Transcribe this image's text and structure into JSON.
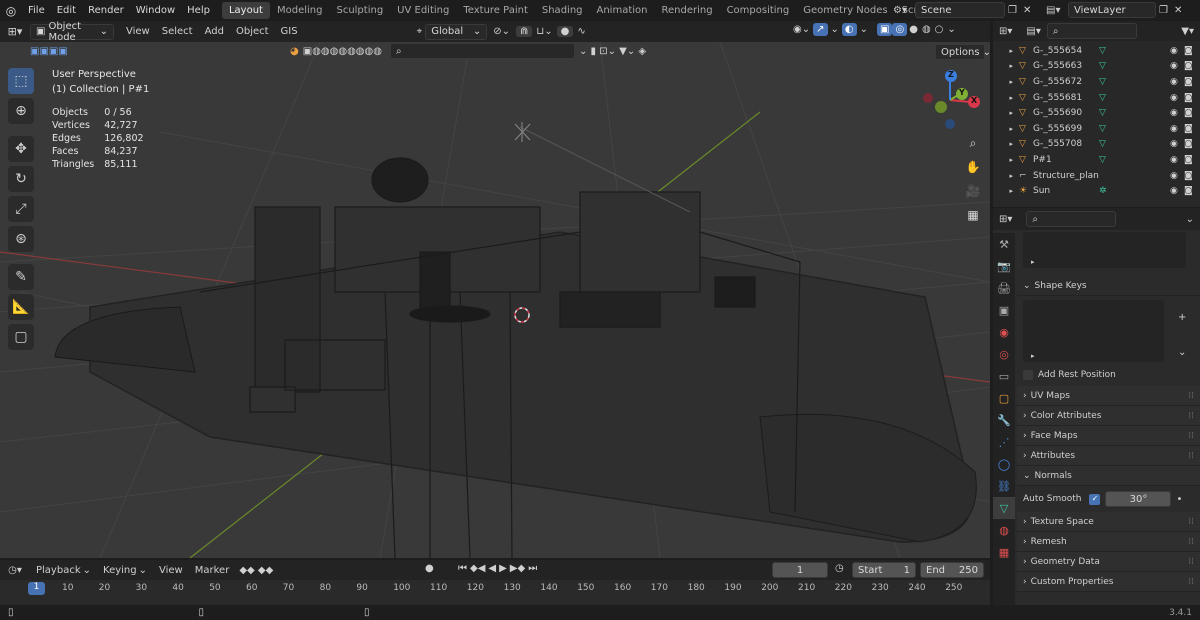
{
  "topbar": {
    "menus": [
      "File",
      "Edit",
      "Render",
      "Window",
      "Help"
    ],
    "workspaces": [
      "Layout",
      "Modeling",
      "Sculpting",
      "UV Editing",
      "Texture Paint",
      "Shading",
      "Animation",
      "Rendering",
      "Compositing",
      "Geometry Nodes",
      "Scripting"
    ],
    "active_workspace": "Layout",
    "add_tab": "+",
    "scene": "Scene",
    "view_layer": "ViewLayer"
  },
  "viewport_header": {
    "mode": "Object Mode",
    "menus": [
      "View",
      "Select",
      "Add",
      "Object",
      "GIS"
    ],
    "orientation": "Global",
    "options": "Options"
  },
  "overlay": {
    "perspective": "User Perspective",
    "collection": "(1) Collection | P#1",
    "stats": [
      {
        "label": "Objects",
        "value": "0 / 56"
      },
      {
        "label": "Vertices",
        "value": "42,727"
      },
      {
        "label": "Edges",
        "value": "126,802"
      },
      {
        "label": "Faces",
        "value": "84,237"
      },
      {
        "label": "Triangles",
        "value": "85,111"
      }
    ]
  },
  "gizmo": {
    "x": "X",
    "y": "Y",
    "z": "Z"
  },
  "outliner": {
    "items": [
      {
        "name": "G-_555654"
      },
      {
        "name": "G-_555663"
      },
      {
        "name": "G-_555672"
      },
      {
        "name": "G-_555681"
      },
      {
        "name": "G-_555690"
      },
      {
        "name": "G-_555699"
      },
      {
        "name": "G-_555708"
      },
      {
        "name": "P#1"
      },
      {
        "name": "Structure_plans"
      },
      {
        "name": "Sun"
      }
    ]
  },
  "properties": {
    "shape_keys": "Shape Keys",
    "add_rest_position": "Add Rest Position",
    "panels_a": [
      "UV Maps",
      "Color Attributes",
      "Face Maps",
      "Attributes"
    ],
    "normals": "Normals",
    "auto_smooth": "Auto Smooth",
    "auto_smooth_angle": "30°",
    "panels_b": [
      "Texture Space",
      "Remesh",
      "Geometry Data",
      "Custom Properties"
    ]
  },
  "timeline": {
    "menus": [
      "Playback",
      "Keying",
      "View",
      "Marker"
    ],
    "current_frame": "1",
    "start_label": "Start",
    "start": "1",
    "end_label": "End",
    "end": "250",
    "ruler": [
      "10",
      "20",
      "30",
      "40",
      "50",
      "60",
      "70",
      "80",
      "90",
      "100",
      "110",
      "120",
      "130",
      "140",
      "150",
      "160",
      "170",
      "180",
      "190",
      "200",
      "210",
      "220",
      "230",
      "240",
      "250"
    ],
    "playhead": "1"
  },
  "status": {
    "version": "3.4.1"
  },
  "colors": {
    "accent": "#4772b3",
    "x_axis": "#d9384a",
    "y_axis": "#7fb034",
    "z_axis": "#3a7ee0"
  }
}
